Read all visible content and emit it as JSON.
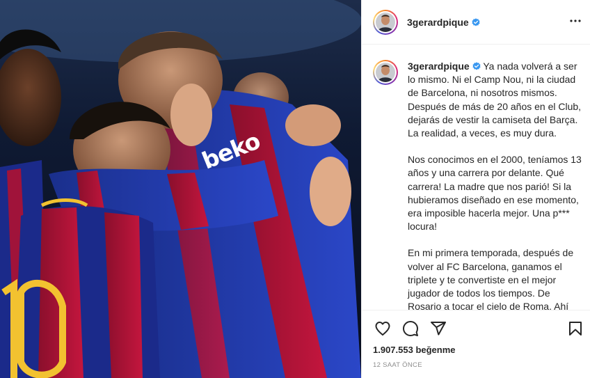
{
  "post": {
    "username": "3gerardpique",
    "photo_alt": "beko"
  },
  "caption": {
    "author": "3gerardpique",
    "paragraphs": [
      "Ya nada volverá a ser lo mismo. Ni el Camp Nou, ni la ciudad de Barcelona, ni nosotros mismos. Después de más de 20 años en el Club, dejarás de vestir la camiseta del Barça. La realidad, a veces, es muy dura.",
      "Nos conocimos en el 2000, teníamos 13 años y una carrera por delante. Qué carrera! La madre que nos parió! Si la hubieramos diseñado en ese momento, era imposible hacerla mejor. Una p*** locura!",
      "En mi primera temporada, después de volver al FC Barcelona, ganamos el triplete y te convertiste en el mejor jugador de todos los tiempos. De Rosario a tocar el cielo de Roma. Ahí"
    ]
  },
  "footer": {
    "likes": "1.907.553 beğenme",
    "timestamp": "12 SAAT ÖNCE"
  },
  "icons": {
    "verified": "verified-badge-icon",
    "more": "more-options-icon",
    "like": "heart-icon",
    "comment": "comment-icon",
    "share": "paper-plane-icon",
    "save": "bookmark-icon"
  },
  "colors": {
    "verified_blue": "#3897f0",
    "text": "#262626",
    "muted": "#8e8e8e",
    "border": "#efefef"
  }
}
